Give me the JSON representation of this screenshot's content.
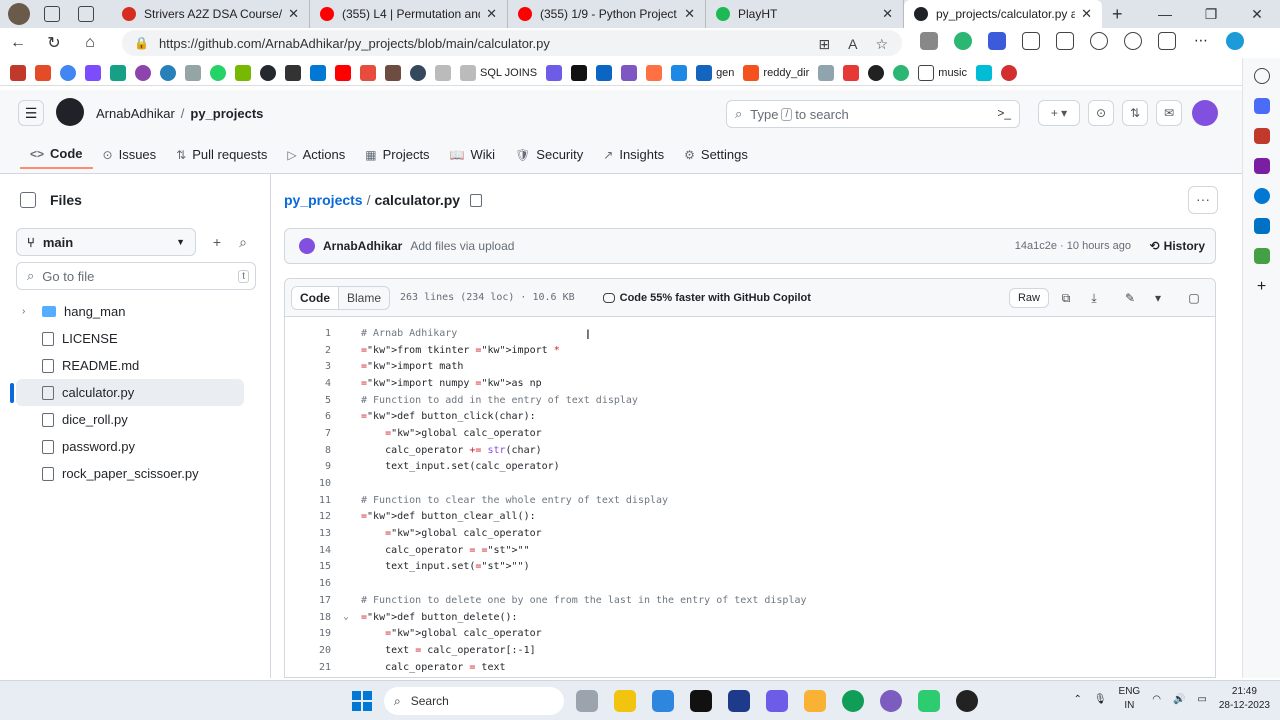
{
  "browser": {
    "tabs": [
      {
        "label": "Strivers A2Z DSA Course/Sheet -",
        "color": "#d62d20"
      },
      {
        "label": "(355) L4 | Permutation and Comb",
        "color": "#ff0000"
      },
      {
        "label": "(355) 1/9 - Python Project Tutori",
        "color": "#ff0000"
      },
      {
        "label": "PlayHT",
        "color": "#1db954"
      },
      {
        "label": "py_projects/calculator.py at main",
        "color": "#1f2328"
      }
    ],
    "url": "https://github.com/ArnabAdhikar/py_projects/blob/main/calculator.py",
    "bookmarks": [
      {
        "label": "SQL JOINS"
      },
      {
        "label": "gen"
      },
      {
        "label": "reddy_dir"
      },
      {
        "label": "music"
      }
    ]
  },
  "github": {
    "owner": "ArnabAdhikar",
    "repo": "py_projects",
    "search_placeholder": "Type",
    "search_key": "/",
    "search_suffix": "to search",
    "nav": [
      {
        "label": "Code",
        "icon": "<>"
      },
      {
        "label": "Issues",
        "icon": "⊙"
      },
      {
        "label": "Pull requests",
        "icon": "⇅"
      },
      {
        "label": "Actions",
        "icon": "▷"
      },
      {
        "label": "Projects",
        "icon": "▦"
      },
      {
        "label": "Wiki",
        "icon": "📖"
      },
      {
        "label": "Security",
        "icon": "🛡"
      },
      {
        "label": "Insights",
        "icon": "↗"
      },
      {
        "label": "Settings",
        "icon": "⚙"
      }
    ]
  },
  "files_panel": {
    "title": "Files",
    "branch": "main",
    "goto_placeholder": "Go to file",
    "goto_key": "t",
    "items": [
      {
        "name": "hang_man",
        "type": "folder"
      },
      {
        "name": "LICENSE",
        "type": "file"
      },
      {
        "name": "README.md",
        "type": "file"
      },
      {
        "name": "calculator.py",
        "type": "file"
      },
      {
        "name": "dice_roll.py",
        "type": "file"
      },
      {
        "name": "password.py",
        "type": "file"
      },
      {
        "name": "rock_paper_scissoer.py",
        "type": "file"
      }
    ]
  },
  "file": {
    "repo_link": "py_projects",
    "name": "calculator.py",
    "commit_author": "ArnabAdhikar",
    "commit_message": "Add files via upload",
    "commit_meta": "14a1c2e · 10 hours ago",
    "history_label": "History",
    "tab_code": "Code",
    "tab_blame": "Blame",
    "stats": "263 lines (234 loc) · 10.6 KB",
    "copilot": "Code 55% faster with GitHub Copilot",
    "raw_label": "Raw"
  },
  "code_lines": [
    {
      "n": "1",
      "t": "# Arnab Adhikary"
    },
    {
      "n": "2",
      "t": "from tkinter import *"
    },
    {
      "n": "3",
      "t": "import math"
    },
    {
      "n": "4",
      "t": "import numpy as np"
    },
    {
      "n": "5",
      "t": "# Function to add in the entry of text display"
    },
    {
      "n": "6",
      "t": "def button_click(char):"
    },
    {
      "n": "7",
      "t": "    global calc_operator"
    },
    {
      "n": "8",
      "t": "    calc_operator += str(char)"
    },
    {
      "n": "9",
      "t": "    text_input.set(calc_operator)"
    },
    {
      "n": "10",
      "t": ""
    },
    {
      "n": "11",
      "t": "# Function to clear the whole entry of text display"
    },
    {
      "n": "12",
      "t": "def button_clear_all():"
    },
    {
      "n": "13",
      "t": "    global calc_operator"
    },
    {
      "n": "14",
      "t": "    calc_operator = \"\""
    },
    {
      "n": "15",
      "t": "    text_input.set(\"\")"
    },
    {
      "n": "16",
      "t": ""
    },
    {
      "n": "17",
      "t": "# Function to delete one by one from the last in the entry of text display"
    },
    {
      "n": "18",
      "t": "def button_delete():"
    },
    {
      "n": "19",
      "t": "    global calc_operator"
    },
    {
      "n": "20",
      "t": "    text = calc_operator[:-1]"
    },
    {
      "n": "21",
      "t": "    calc_operator = text"
    }
  ],
  "taskbar": {
    "search": "Search",
    "lang_top": "ENG",
    "lang_bottom": "IN",
    "time": "21:49",
    "date": "28-12-2023"
  }
}
